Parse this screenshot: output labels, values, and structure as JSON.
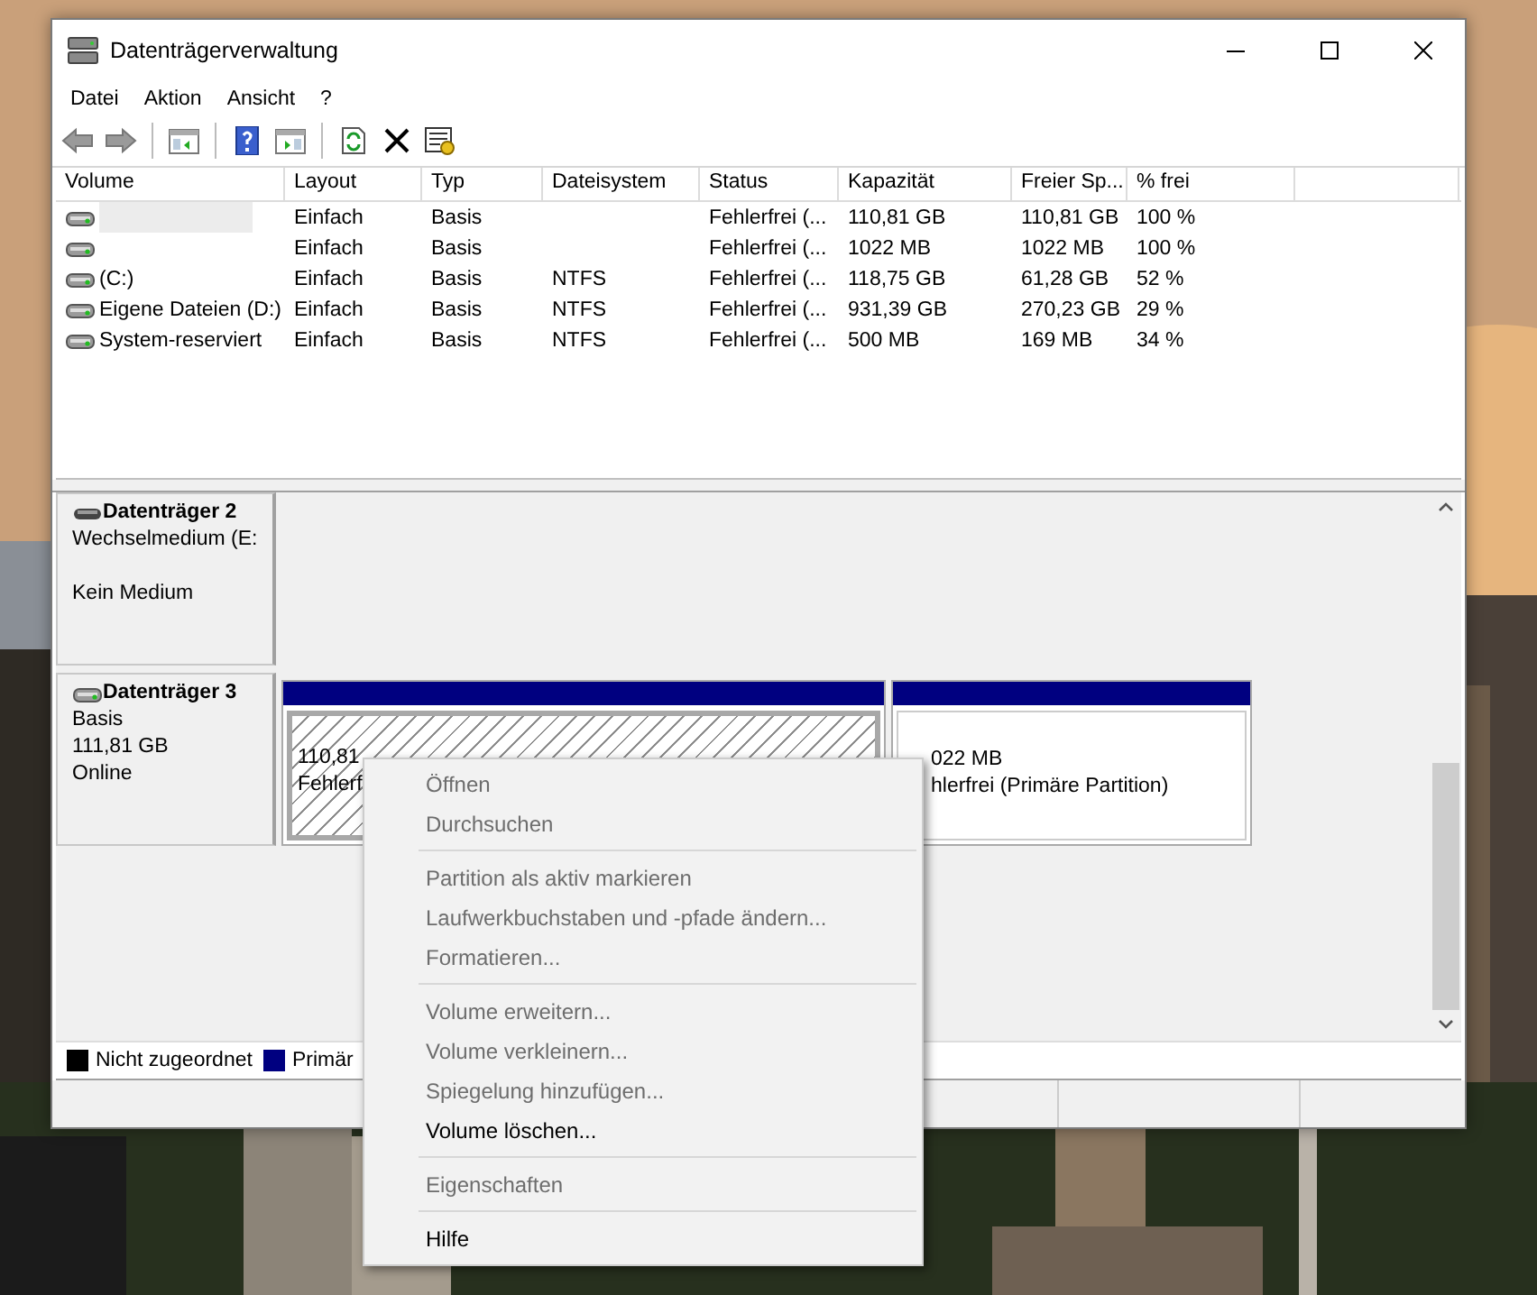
{
  "window": {
    "title": "Datenträgerverwaltung"
  },
  "menu": [
    "Datei",
    "Aktion",
    "Ansicht",
    "?"
  ],
  "volumes": {
    "columns": [
      "Volume",
      "Layout",
      "Typ",
      "Dateisystem",
      "Status",
      "Kapazität",
      "Freier Sp...",
      "% frei"
    ],
    "rows": [
      {
        "selected": true,
        "layout": "Einfach",
        "type": "Basis",
        "status": "Fehlerfrei (...",
        "capacity": "110,81 GB",
        "free": "110,81 GB",
        "percent_free": "100 %"
      },
      {
        "selected": false,
        "layout": "Einfach",
        "type": "Basis",
        "status": "Fehlerfrei (...",
        "capacity": "1022 MB",
        "free": "1022 MB",
        "percent_free": "100 %"
      },
      {
        "selected": false,
        "volume": "(C:)",
        "layout": "Einfach",
        "type": "Basis",
        "filesystem": "NTFS",
        "status": "Fehlerfrei (...",
        "capacity": "118,75 GB",
        "free": "61,28 GB",
        "percent_free": "52 %"
      },
      {
        "selected": false,
        "volume": "Eigene Dateien (D:)",
        "layout": "Einfach",
        "type": "Basis",
        "filesystem": "NTFS",
        "status": "Fehlerfrei (...",
        "capacity": "931,39 GB",
        "free": "270,23 GB",
        "percent_free": "29 %"
      },
      {
        "selected": false,
        "volume": "System-reserviert",
        "layout": "Einfach",
        "type": "Basis",
        "filesystem": "NTFS",
        "status": "Fehlerfrei (...",
        "capacity": "500 MB",
        "free": "169 MB",
        "percent_free": "34 %"
      }
    ]
  },
  "disks": [
    {
      "kind": "removable",
      "name": "Datenträger 2",
      "type": "Wechselmedium (E:",
      "status": "Kein Medium"
    },
    {
      "kind": "basic",
      "name": "Datenträger 3",
      "type": "Basis",
      "size": "111,81 GB",
      "status": "Online",
      "partitions": [
        {
          "selected": true,
          "size": "110,81",
          "status": "Fehlerf"
        },
        {
          "selected": false,
          "size": "022 MB",
          "status": "hlerfrei (Primäre Partition)"
        }
      ]
    }
  ],
  "legend": [
    {
      "label": "Nicht zugeordnet",
      "color": "#000000"
    },
    {
      "label": "Primär",
      "color": "#000080"
    }
  ],
  "context_menu": [
    [
      {
        "label": "Öffnen",
        "disabled": true
      },
      {
        "label": "Durchsuchen",
        "disabled": true
      }
    ],
    [
      {
        "label": "Partition als aktiv markieren",
        "disabled": true
      },
      {
        "label": "Laufwerkbuchstaben und -pfade ändern...",
        "disabled": true
      },
      {
        "label": "Formatieren...",
        "disabled": true
      }
    ],
    [
      {
        "label": "Volume erweitern...",
        "disabled": true
      },
      {
        "label": "Volume verkleinern...",
        "disabled": true
      },
      {
        "label": "Spiegelung hinzufügen...",
        "disabled": true
      },
      {
        "label": "Volume löschen...",
        "disabled": false
      }
    ],
    [
      {
        "label": "Eigenschaften",
        "disabled": true
      }
    ],
    [
      {
        "label": "Hilfe",
        "disabled": false
      }
    ]
  ]
}
